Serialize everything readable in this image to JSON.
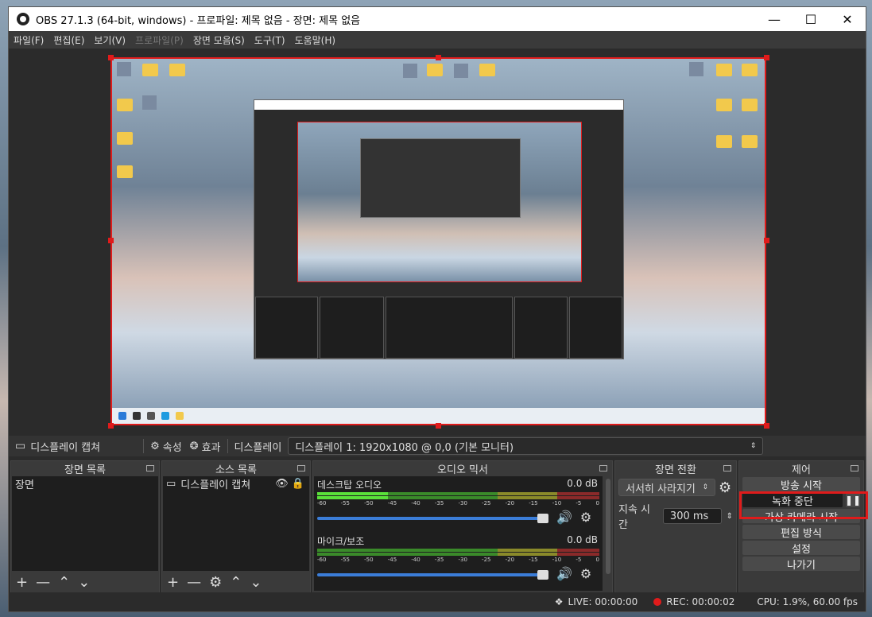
{
  "window": {
    "title": "OBS 27.1.3 (64-bit, windows) - 프로파일: 제목 없음 - 장면: 제목 없음",
    "minimize_icon": "minimize-icon",
    "maximize_icon": "maximize-icon",
    "close_icon": "close-icon"
  },
  "menu": {
    "file": "파일(F)",
    "edit": "편집(E)",
    "view": "보기(V)",
    "profile": "프로파일(P)",
    "scene_collection": "장면 모음(S)",
    "tools": "도구(T)",
    "help": "도움말(H)"
  },
  "source_toolbar": {
    "source_name": "디스플레이 캡쳐",
    "properties_label": "속성",
    "filters_label": "효과",
    "display_label": "디스플레이",
    "display_value": "디스플레이 1: 1920x1080 @ 0,0 (기본 모니터)"
  },
  "scenes": {
    "header": "장면 목록",
    "items": [
      "장면"
    ]
  },
  "sources": {
    "header": "소스 목록",
    "items": [
      "디스플레이 캡쳐"
    ]
  },
  "mixer": {
    "header": "오디오 믹서",
    "scale": [
      "-60",
      "-55",
      "-50",
      "-45",
      "-40",
      "-35",
      "-30",
      "-25",
      "-20",
      "-15",
      "-10",
      "-5",
      "0"
    ],
    "channels": [
      {
        "name": "데스크탑 오디오",
        "db": "0.0 dB",
        "volume_fraction": 1.0
      },
      {
        "name": "마이크/보조",
        "db": "0.0 dB",
        "volume_fraction": 1.0
      }
    ]
  },
  "transitions": {
    "header": "장면 전환",
    "selected": "서서히 사라지기",
    "duration_label": "지속 시간",
    "duration_value": "300 ms"
  },
  "controls": {
    "header": "제어",
    "buttons": [
      "방송 시작",
      "녹화 중단",
      "가상 카메라 시작",
      "편집 방식",
      "설정",
      "나가기"
    ]
  },
  "status": {
    "live": "LIVE: 00:00:00",
    "rec": "REC: 00:00:02",
    "cpu": "CPU: 1.9%, 60.00 fps"
  },
  "colors": {
    "accent_red": "#e01b1b",
    "slider_blue": "#3b7dd8"
  }
}
